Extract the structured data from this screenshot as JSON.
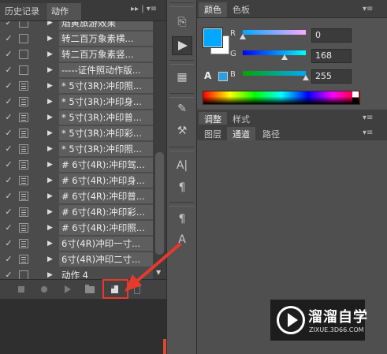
{
  "left_panel": {
    "tabs": [
      "历史记录",
      "动作"
    ],
    "active_tab": "动作",
    "tab_controls": "▸▸ | ▾≡",
    "rows": [
      {
        "checked": true,
        "dialog": false,
        "label": "焰黄旅游效果"
      },
      {
        "checked": true,
        "dialog": false,
        "label": "转二百万象素横..."
      },
      {
        "checked": true,
        "dialog": false,
        "label": "转二百万象素竖..."
      },
      {
        "checked": true,
        "dialog": false,
        "label": "-----证件照动作版..."
      },
      {
        "checked": true,
        "dialog": true,
        "label": "* 5寸(3R):冲印照..."
      },
      {
        "checked": true,
        "dialog": true,
        "label": "* 5寸(3R):冲印身..."
      },
      {
        "checked": true,
        "dialog": true,
        "label": "* 5寸(3R):冲印普..."
      },
      {
        "checked": true,
        "dialog": true,
        "label": "* 5寸(3R):冲印彩..."
      },
      {
        "checked": true,
        "dialog": true,
        "label": "* 5寸(3R):冲印照..."
      },
      {
        "checked": true,
        "dialog": true,
        "label": "#  6寸(4R):冲印驾..."
      },
      {
        "checked": true,
        "dialog": true,
        "label": "#  6寸(4R):冲印身..."
      },
      {
        "checked": true,
        "dialog": true,
        "label": "#  6寸(4R):冲印普..."
      },
      {
        "checked": true,
        "dialog": true,
        "label": "#  6寸(4R):冲印彩..."
      },
      {
        "checked": true,
        "dialog": true,
        "label": "#  6寸(4R):冲印照..."
      },
      {
        "checked": true,
        "dialog": true,
        "label": "6寸(4R)冲印一寸..."
      },
      {
        "checked": true,
        "dialog": true,
        "label": "6寸(4R)冲印二寸..."
      },
      {
        "checked": true,
        "dialog": false,
        "label": "动作 4"
      }
    ]
  },
  "right_panel": {
    "color_tabs": [
      "颜色",
      "色板"
    ],
    "adjust_tabs": [
      "调整",
      "样式"
    ],
    "layer_tabs": [
      "图层",
      "通道",
      "路径"
    ],
    "active_layer_tab": "通道",
    "channels": [
      {
        "name": "R",
        "value": "0",
        "fraction": 0.0
      },
      {
        "name": "G",
        "value": "168",
        "fraction": 0.659
      },
      {
        "name": "B",
        "value": "255",
        "fraction": 1.0
      }
    ],
    "foreground_color": "#00a8ff",
    "background_color": "#ffffff"
  },
  "watermark": {
    "title": "溜溜自学",
    "url": "ZIXUE.3D66.COM"
  },
  "colors": {
    "highlight": "#e53a2c",
    "arrow": "#e53a2c"
  }
}
